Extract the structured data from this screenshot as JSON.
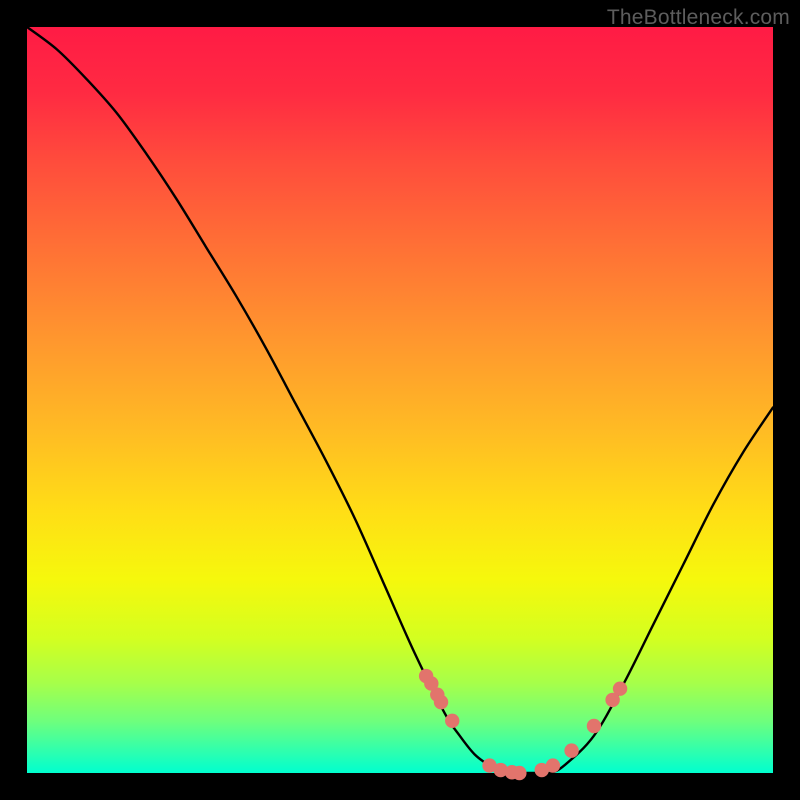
{
  "watermark": "TheBottleneck.com",
  "chart_data": {
    "type": "line",
    "title": "",
    "xlabel": "",
    "ylabel": "",
    "xlim": [
      0,
      100
    ],
    "ylim": [
      0,
      100
    ],
    "series": [
      {
        "name": "bottleneck-curve",
        "x": [
          0,
          4,
          8,
          12,
          16,
          20,
          24,
          28,
          32,
          36,
          40,
          44,
          48,
          52,
          56,
          58,
          60,
          62,
          64,
          66,
          68,
          70,
          72,
          76,
          80,
          84,
          88,
          92,
          96,
          100
        ],
        "y": [
          100,
          97,
          93,
          88.5,
          83,
          77,
          70.5,
          64,
          57,
          49.5,
          42,
          34,
          25,
          16,
          8,
          5,
          2.5,
          1,
          0,
          0,
          0,
          0,
          1,
          5,
          12,
          20,
          28,
          36,
          43,
          49
        ]
      }
    ],
    "points": {
      "name": "highlight-points",
      "color": "#e2746c",
      "x": [
        53.5,
        54.2,
        55.0,
        55.5,
        57.0,
        62.0,
        63.5,
        65.0,
        66.0,
        69.0,
        70.5,
        73.0,
        76.0,
        78.5,
        79.5
      ],
      "y": [
        13.0,
        12.0,
        10.5,
        9.5,
        7.0,
        1.0,
        0.4,
        0.1,
        0.0,
        0.4,
        1.0,
        3.0,
        6.3,
        9.8,
        11.3
      ]
    }
  }
}
